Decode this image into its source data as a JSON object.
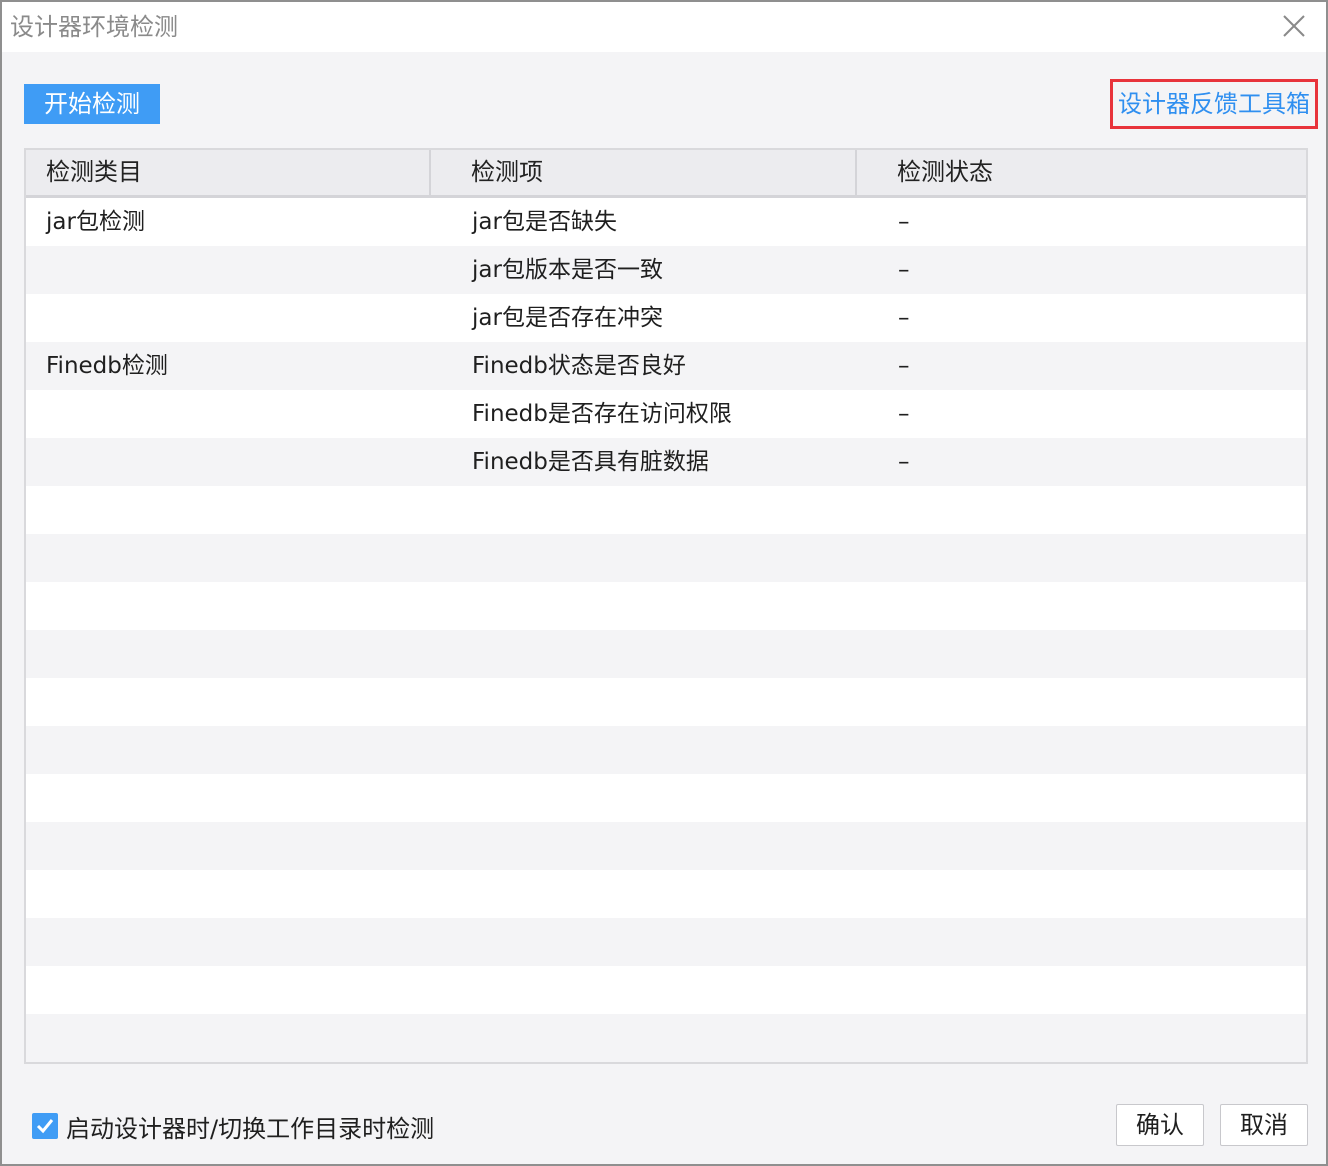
{
  "window": {
    "title": "设计器环境检测"
  },
  "toolbar": {
    "start_label": "开始检测",
    "feedback_label": "设计器反馈工具箱"
  },
  "table": {
    "headers": [
      "检测类目",
      "检测项",
      "检测状态"
    ],
    "rows": [
      {
        "category": "jar包检测",
        "item": "jar包是否缺失",
        "status": "–"
      },
      {
        "category": "",
        "item": "jar包版本是否一致",
        "status": "–"
      },
      {
        "category": "",
        "item": "jar包是否存在冲突",
        "status": "–"
      },
      {
        "category": "Finedb检测",
        "item": "Finedb状态是否良好",
        "status": "–"
      },
      {
        "category": "",
        "item": "Finedb是否存在访问权限",
        "status": "–"
      },
      {
        "category": "",
        "item": "Finedb是否具有脏数据",
        "status": "–"
      }
    ]
  },
  "footer": {
    "checkbox_label": "启动设计器时/切换工作目录时检测",
    "checkbox_checked": true,
    "confirm_label": "确认",
    "cancel_label": "取消"
  },
  "colors": {
    "accent": "#3f9cf5",
    "link": "#2f8ff0",
    "highlight_border": "#e8333b"
  }
}
